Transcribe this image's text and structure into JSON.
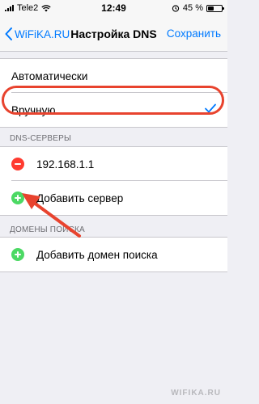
{
  "status_bar": {
    "carrier": "Tele2",
    "time": "12:49",
    "battery_text": "45 %",
    "battery_level": 0.45
  },
  "nav": {
    "back_label": "WiFiKA.RU",
    "title": "Настройка DNS",
    "save_label": "Сохранить"
  },
  "mode": {
    "auto_label": "Автоматически",
    "manual_label": "Вручную",
    "selected": "manual"
  },
  "dns_servers": {
    "header": "DNS-СЕРВЕРЫ",
    "items": [
      {
        "address": "192.168.1.1"
      }
    ],
    "add_label": "Добавить сервер"
  },
  "search_domains": {
    "header": "ДОМЕНЫ ПОИСКА",
    "add_label": "Добавить домен поиска"
  },
  "watermark": "WIFIKA.RU",
  "colors": {
    "accent": "#007aff",
    "remove": "#ff3b30",
    "add": "#4cd964",
    "annotation": "#e8432e"
  }
}
